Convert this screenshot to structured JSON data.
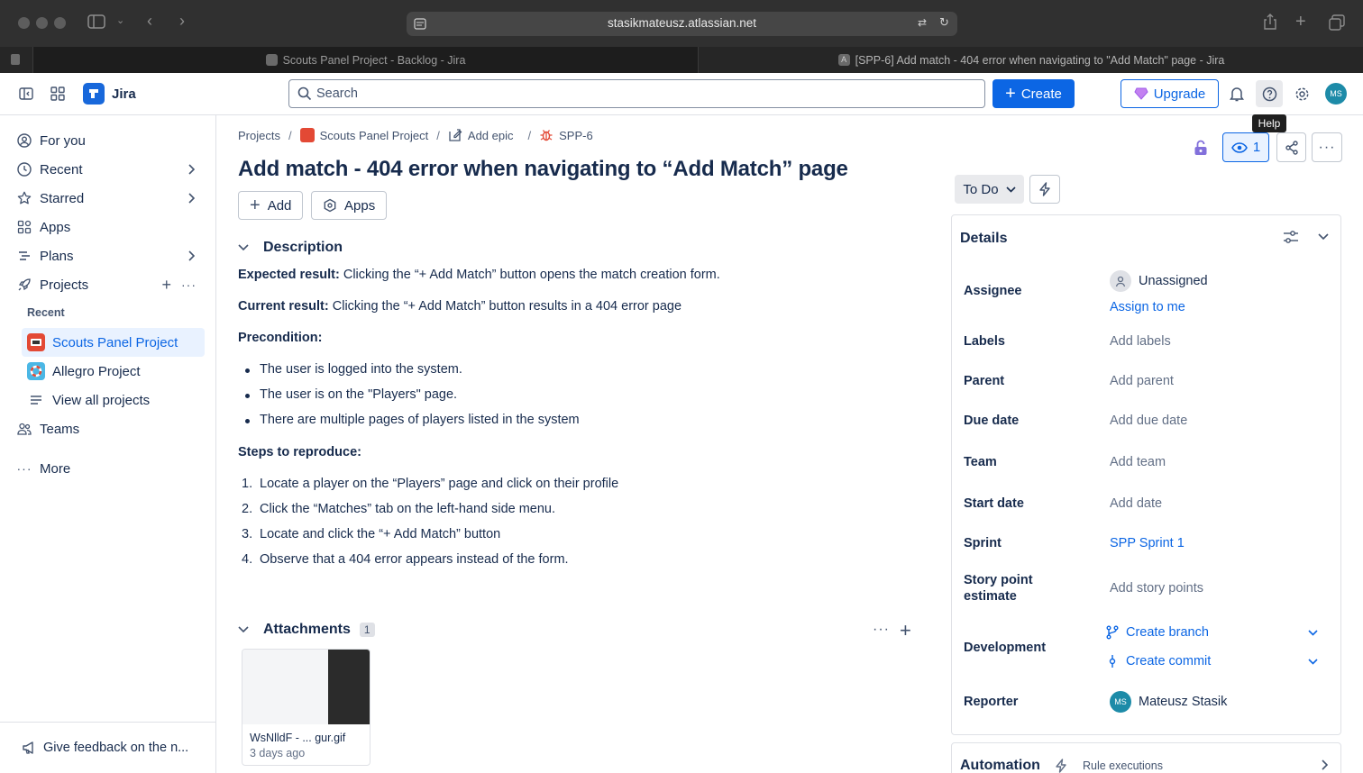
{
  "browser": {
    "url": "stasikmateusz.atlassian.net",
    "tabs": [
      {
        "label": "Scouts Panel Project - Backlog - Jira"
      },
      {
        "label": "[SPP-6] Add match - 404 error when navigating to \"Add Match\" page - Jira"
      }
    ]
  },
  "topbar": {
    "app_name": "Jira",
    "search_placeholder": "Search",
    "create_label": "Create",
    "upgrade_label": "Upgrade",
    "avatar_initials": "MS",
    "help_tooltip": "Help"
  },
  "sidebar": {
    "items": [
      {
        "label": "For you"
      },
      {
        "label": "Recent"
      },
      {
        "label": "Starred"
      },
      {
        "label": "Apps"
      },
      {
        "label": "Plans"
      },
      {
        "label": "Projects"
      }
    ],
    "recent_heading": "Recent",
    "projects": [
      {
        "label": "Scouts Panel Project"
      },
      {
        "label": "Allegro Project"
      },
      {
        "label": "View all projects"
      }
    ],
    "teams_label": "Teams",
    "more_label": "More",
    "feedback_label": "Give feedback on the n..."
  },
  "breadcrumb": {
    "projects": "Projects",
    "project": "Scouts Panel Project",
    "epic": "Add epic",
    "issue": "SPP-6"
  },
  "issue": {
    "title": "Add match - 404 error when navigating to “Add Match” page",
    "add_label": "Add",
    "apps_label": "Apps",
    "description_heading": "Description",
    "expected_label": "Expected result:",
    "expected_text": " Clicking the “+ Add Match” button opens the match creation form.",
    "current_label": "Current result:",
    "current_text": " Clicking the “+ Add Match” button results in a 404 error page",
    "precondition_label": "Precondition:",
    "preconditions": [
      "The user is logged into the system.",
      "The user is on the \"Players\" page.",
      "There are multiple pages of players listed in the system"
    ],
    "steps_label": "Steps to reproduce:",
    "steps": [
      "Locate a player on the “Players” page and click on their profile",
      "Click the “Matches” tab on the left-hand side menu.",
      "Locate and click the “+ Add Match” button",
      "Observe that a 404 error appears instead of the form."
    ],
    "attachments_heading": "Attachments",
    "attachments_count": "1",
    "attachment": {
      "name": "WsNlldF - ... gur.gif",
      "date": "3 days ago"
    }
  },
  "panel": {
    "watch_count": "1",
    "status": "To Do",
    "details_heading": "Details",
    "rows": {
      "assignee_label": "Assignee",
      "assignee_value": "Unassigned",
      "assign_to_me": "Assign to me",
      "labels_label": "Labels",
      "labels_value": "Add labels",
      "parent_label": "Parent",
      "parent_value": "Add parent",
      "due_label": "Due date",
      "due_value": "Add due date",
      "team_label": "Team",
      "team_value": "Add team",
      "start_label": "Start date",
      "start_value": "Add date",
      "sprint_label": "Sprint",
      "sprint_value": "SPP Sprint 1",
      "sp_label": "Story point estimate",
      "sp_value": "Add story points",
      "dev_label": "Development",
      "create_branch": "Create branch",
      "create_commit": "Create commit",
      "reporter_label": "Reporter",
      "reporter_initials": "MS",
      "reporter_value": "Mateusz Stasik"
    },
    "automation_heading": "Automation",
    "rule_executions": "Rule executions"
  },
  "colors": {
    "brand": "#0c66e4",
    "jira_logo": "#1868db",
    "avatar": "#1d8ba8",
    "project_red": "#e34935"
  }
}
